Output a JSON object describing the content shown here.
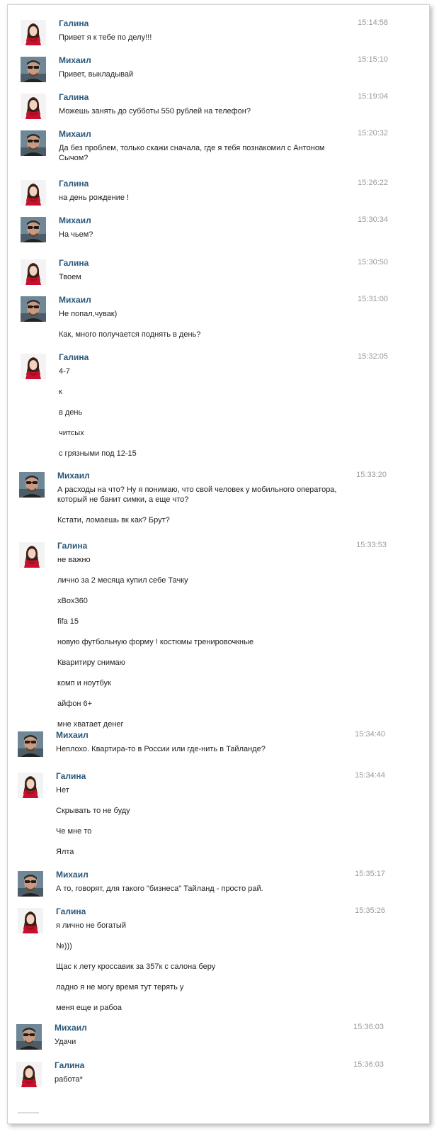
{
  "messages": [
    {
      "author": "Галина",
      "avatar": "galina-avatar",
      "time": "15:14:58",
      "lines": [
        "Привет я к тебе по делу!!!"
      ]
    },
    {
      "author": "Михаил",
      "avatar": "mikhail-avatar",
      "time": "15:15:10",
      "lines": [
        "Привет, выкладывай"
      ]
    },
    {
      "author": "Галина",
      "avatar": "galina-avatar",
      "time": "15:19:04",
      "lines": [
        "Можешь занять до субботы 550 рублей на телефон?"
      ]
    },
    {
      "author": "Михаил",
      "avatar": "mikhail-avatar",
      "time": "15:20:32",
      "lines": [
        "Да без проблем, только скажи сначала, где я тебя познакомил с Антоном Сычом?"
      ]
    },
    {
      "author": "Галина",
      "avatar": "galina-avatar",
      "time": "15:26:22",
      "lines": [
        "на день рождение !"
      ]
    },
    {
      "author": "Михаил",
      "avatar": "mikhail-avatar",
      "time": "15:30:34",
      "lines": [
        "На чьем?"
      ]
    },
    {
      "author": "Галина",
      "avatar": "galina-avatar",
      "time": "15:30:50",
      "lines": [
        "Твоем"
      ]
    },
    {
      "author": "Михаил",
      "avatar": "mikhail-avatar",
      "time": "15:31:00",
      "lines": [
        "Не попал,чувак)",
        "Как, много получается поднять в день?"
      ]
    },
    {
      "author": "Галина",
      "avatar": "galina-avatar",
      "time": "15:32:05",
      "lines": [
        "4-7",
        "к",
        "в день",
        "читсых",
        "с грязными под 12-15"
      ]
    },
    {
      "author": "Михаил",
      "avatar": "mikhail-avatar",
      "time": "15:33:20",
      "lines": [
        "А расходы на что? Ну я понимаю, что свой человек у мобильного оператора, который не банит симки, а еще что?",
        "Кстати, ломаешь вк как? Брут?"
      ]
    },
    {
      "author": "Галина",
      "avatar": "galina-avatar",
      "time": "15:33:53",
      "lines": [
        "не важно",
        "лично за 2 месяца купил себе Тачку",
        "xBox360",
        "fifa 15",
        "новую футбольную форму ! костюмы тренировочкные",
        "Кваритиру снимаю",
        "комп и ноутбук",
        "айфон 6+",
        "мне хватает денег"
      ]
    },
    {
      "author": "Михаил",
      "avatar": "mikhail-avatar",
      "time": "15:34:40",
      "lines": [
        "Неплохо. Квартира-то в России или где-нить в Тайланде?"
      ]
    },
    {
      "author": "Галина",
      "avatar": "galina-avatar",
      "time": "15:34:44",
      "lines": [
        "Нет",
        "Скрывать то не буду",
        "Че мне то",
        "Ялта"
      ]
    },
    {
      "author": "Михаил",
      "avatar": "mikhail-avatar",
      "time": "15:35:17",
      "lines": [
        "А то, говорят, для такого \"бизнеса\" Тайланд - просто рай."
      ]
    },
    {
      "author": "Галина",
      "avatar": "galina-avatar",
      "time": "15:35:26",
      "lines": [
        "я лично не богатый",
        "№)))",
        "Щас к лету кроссавик за 357к с салона беру",
        "ладно я не могу время тут терять у",
        "меня еще и рабоа"
      ]
    },
    {
      "author": "Михаил",
      "avatar": "mikhail-avatar",
      "time": "15:36:03",
      "lines": [
        "Удачи"
      ]
    },
    {
      "author": "Галина",
      "avatar": "galina-avatar",
      "time": "15:36:03",
      "lines": [
        "работа*"
      ]
    }
  ],
  "colors": {
    "author": "#2b587a",
    "text": "#222222",
    "time": "#999999",
    "border": "#cfd3d8",
    "galina_scarf": "#c8102e",
    "galina_hair": "#3a1f17"
  }
}
